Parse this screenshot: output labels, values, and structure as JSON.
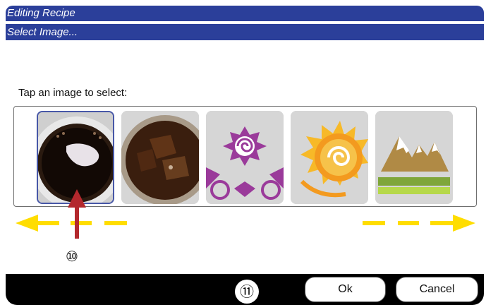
{
  "window": {
    "title": "Editing Recipe",
    "subtitle": "Select Image..."
  },
  "picker": {
    "prompt": "Tap an image to select:",
    "images": [
      {
        "icon": "coffee-cup-image",
        "selected": true
      },
      {
        "icon": "iced-drink-image",
        "selected": false
      },
      {
        "icon": "purple-spiral-pattern-image",
        "selected": false
      },
      {
        "icon": "sun-spiral-image",
        "selected": false
      },
      {
        "icon": "mountains-image",
        "selected": false
      }
    ]
  },
  "annotations": {
    "step_a": "⑩",
    "step_b": "⑪"
  },
  "buttons": {
    "ok": "Ok",
    "cancel": "Cancel"
  },
  "colors": {
    "header": "#2b3f9a",
    "selection_border": "#4757a7",
    "arrow_yellow": "#ffdd00",
    "arrow_red": "#b3282d"
  }
}
